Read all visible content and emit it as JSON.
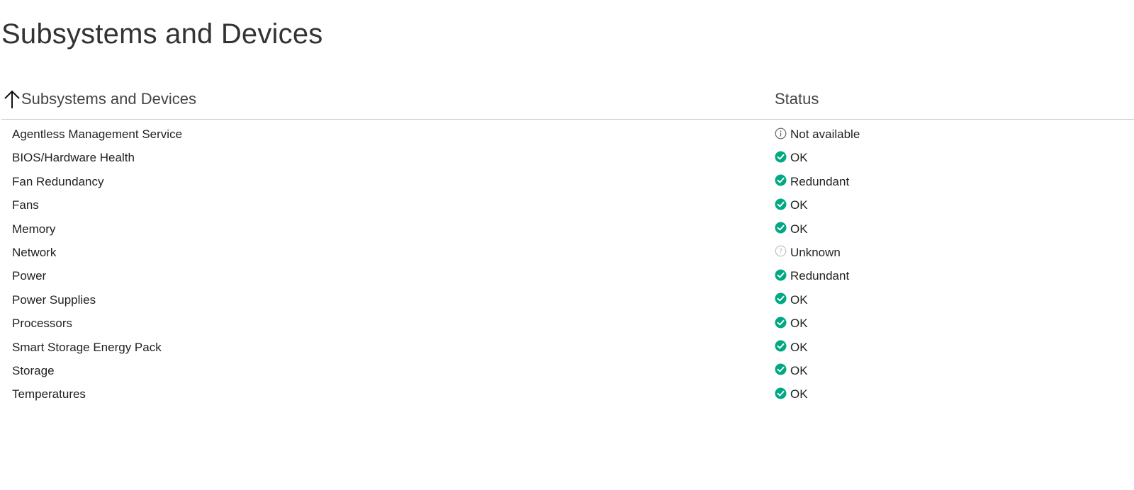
{
  "page": {
    "title": "Subsystems and Devices"
  },
  "table": {
    "columns": {
      "name": "Subsystems and Devices",
      "status": "Status"
    },
    "rows": [
      {
        "name": "Agentless Management Service",
        "status": "Not available",
        "icon": "info-icon"
      },
      {
        "name": "BIOS/Hardware Health",
        "status": "OK",
        "icon": "check-circle-icon"
      },
      {
        "name": "Fan Redundancy",
        "status": "Redundant",
        "icon": "check-circle-icon"
      },
      {
        "name": "Fans",
        "status": "OK",
        "icon": "check-circle-icon"
      },
      {
        "name": "Memory",
        "status": "OK",
        "icon": "check-circle-icon"
      },
      {
        "name": "Network",
        "status": "Unknown",
        "icon": "question-circle-icon"
      },
      {
        "name": "Power",
        "status": "Redundant",
        "icon": "check-circle-icon"
      },
      {
        "name": "Power Supplies",
        "status": "OK",
        "icon": "check-circle-icon"
      },
      {
        "name": "Processors",
        "status": "OK",
        "icon": "check-circle-icon"
      },
      {
        "name": "Smart Storage Energy Pack",
        "status": "OK",
        "icon": "check-circle-icon"
      },
      {
        "name": "Storage",
        "status": "OK",
        "icon": "check-circle-icon"
      },
      {
        "name": "Temperatures",
        "status": "OK",
        "icon": "check-circle-icon"
      }
    ]
  },
  "colors": {
    "ok": "#01a982",
    "info": "#666666",
    "unknown": "#bbbbbb"
  }
}
